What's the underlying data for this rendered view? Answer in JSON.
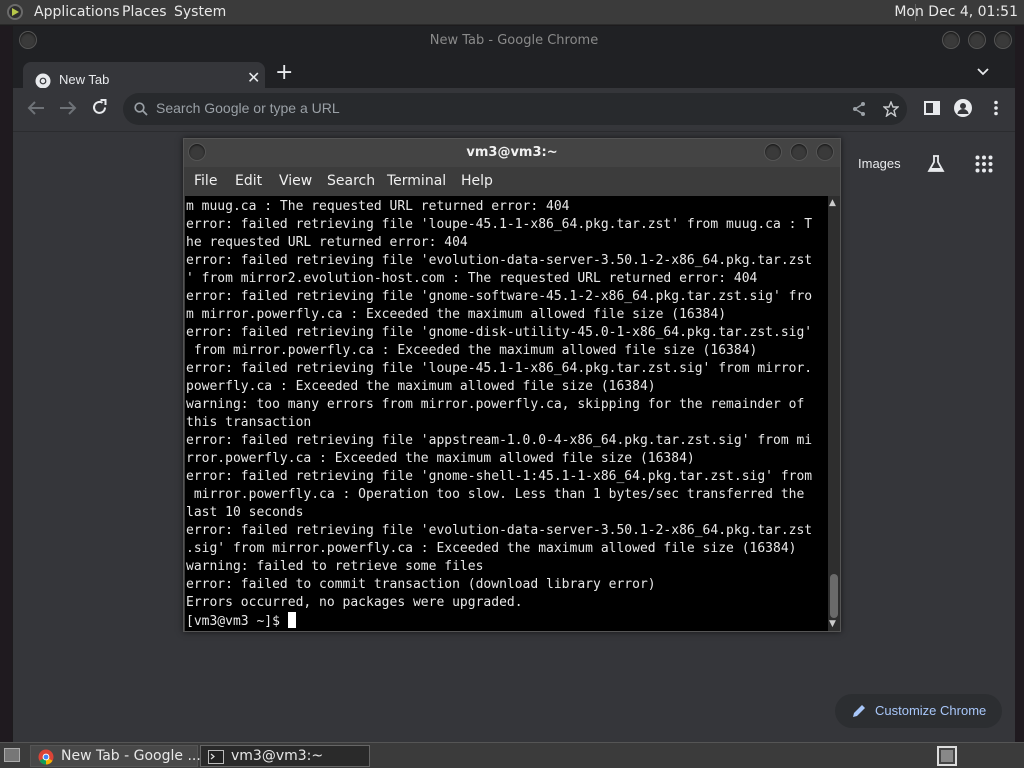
{
  "top_panel": {
    "menus": [
      "Applications",
      "Places",
      "System"
    ],
    "clock": "Mon Dec  4, 01:51"
  },
  "chrome": {
    "window_title": "New Tab - Google Chrome",
    "tab_title": "New Tab",
    "omnibox_placeholder": "Search Google or type a URL",
    "images_link": "Images",
    "customize_label": "Customize Chrome"
  },
  "terminal": {
    "title": "vm3@vm3:~",
    "menus": [
      "File",
      "Edit",
      "View",
      "Search",
      "Terminal",
      "Help"
    ],
    "lines": [
      "m muug.ca : The requested URL returned error: 404",
      "error: failed retrieving file 'loupe-45.1-1-x86_64.pkg.tar.zst' from muug.ca : T",
      "he requested URL returned error: 404",
      "error: failed retrieving file 'evolution-data-server-3.50.1-2-x86_64.pkg.tar.zst",
      "' from mirror2.evolution-host.com : The requested URL returned error: 404",
      "error: failed retrieving file 'gnome-software-45.1-2-x86_64.pkg.tar.zst.sig' fro",
      "m mirror.powerfly.ca : Exceeded the maximum allowed file size (16384)",
      "error: failed retrieving file 'gnome-disk-utility-45.0-1-x86_64.pkg.tar.zst.sig'",
      " from mirror.powerfly.ca : Exceeded the maximum allowed file size (16384)",
      "error: failed retrieving file 'loupe-45.1-1-x86_64.pkg.tar.zst.sig' from mirror.",
      "powerfly.ca : Exceeded the maximum allowed file size (16384)",
      "warning: too many errors from mirror.powerfly.ca, skipping for the remainder of",
      "this transaction",
      "error: failed retrieving file 'appstream-1.0.0-4-x86_64.pkg.tar.zst.sig' from mi",
      "rror.powerfly.ca : Exceeded the maximum allowed file size (16384)",
      "error: failed retrieving file 'gnome-shell-1:45.1-1-x86_64.pkg.tar.zst.sig' from",
      " mirror.powerfly.ca : Operation too slow. Less than 1 bytes/sec transferred the",
      "last 10 seconds",
      "error: failed retrieving file 'evolution-data-server-3.50.1-2-x86_64.pkg.tar.zst",
      ".sig' from mirror.powerfly.ca : Exceeded the maximum allowed file size (16384)",
      "warning: failed to retrieve some files",
      "error: failed to commit transaction (download library error)",
      "Errors occurred, no packages were upgraded."
    ],
    "prompt": "[vm3@vm3 ~]$ "
  },
  "taskbar": {
    "tasks": [
      "New Tab - Google ...",
      "vm3@vm3:~"
    ]
  },
  "colors": {
    "chrome_bg": "#35363a",
    "accent_link": "#a8c7fa",
    "terminal_bg": "#000000"
  }
}
